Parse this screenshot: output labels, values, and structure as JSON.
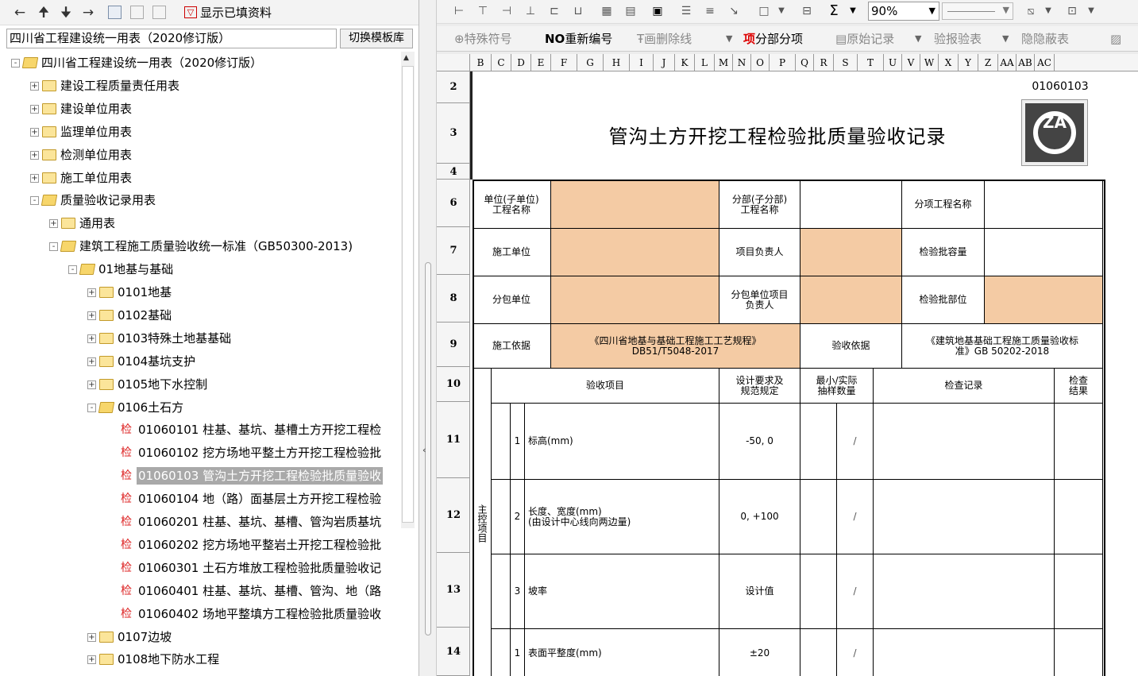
{
  "left_toolbar": {
    "show_filled_label": "显示已填资料",
    "filter_glyph": "▽"
  },
  "template_selector": {
    "value": "四川省工程建设统一用表（2020修订版）",
    "switch_button": "切换模板库"
  },
  "tree": [
    {
      "label": "四川省工程建设统一用表（2020修订版）",
      "level": 0,
      "type": "folder-open",
      "expander": "-"
    },
    {
      "label": "建设工程质量责任用表",
      "level": 1,
      "type": "folder",
      "expander": "+"
    },
    {
      "label": "建设单位用表",
      "level": 1,
      "type": "folder",
      "expander": "+"
    },
    {
      "label": "监理单位用表",
      "level": 1,
      "type": "folder",
      "expander": "+"
    },
    {
      "label": "检测单位用表",
      "level": 1,
      "type": "folder",
      "expander": "+"
    },
    {
      "label": "施工单位用表",
      "level": 1,
      "type": "folder",
      "expander": "+"
    },
    {
      "label": "质量验收记录用表",
      "level": 1,
      "type": "folder-open",
      "expander": "-"
    },
    {
      "label": "通用表",
      "level": 2,
      "type": "folder",
      "expander": "+"
    },
    {
      "label": "建筑工程施工质量验收统一标准（GB50300-2013)",
      "level": 2,
      "type": "folder-open",
      "expander": "-"
    },
    {
      "label": "01地基与基础",
      "level": 3,
      "type": "folder-open",
      "expander": "-"
    },
    {
      "label": "0101地基",
      "level": 4,
      "type": "folder",
      "expander": "+"
    },
    {
      "label": "0102基础",
      "level": 4,
      "type": "folder",
      "expander": "+"
    },
    {
      "label": "0103特殊土地基基础",
      "level": 4,
      "type": "folder",
      "expander": "+"
    },
    {
      "label": "0104基坑支护",
      "level": 4,
      "type": "folder",
      "expander": "+"
    },
    {
      "label": "0105地下水控制",
      "level": 4,
      "type": "folder",
      "expander": "+"
    },
    {
      "label": "0106土石方",
      "level": 4,
      "type": "folder-open",
      "expander": "-"
    },
    {
      "label": "01060101 柱基、基坑、基槽土方开挖工程检",
      "level": 5,
      "type": "check",
      "badge": "检"
    },
    {
      "label": "01060102 挖方场地平整土方开挖工程检验批",
      "level": 5,
      "type": "check",
      "badge": "检"
    },
    {
      "label": "01060103 管沟土方开挖工程检验批质量验收",
      "level": 5,
      "type": "check",
      "badge": "检",
      "selected": true
    },
    {
      "label": "01060104 地（路）面基层土方开挖工程检验",
      "level": 5,
      "type": "check",
      "badge": "检"
    },
    {
      "label": "01060201 柱基、基坑、基槽、管沟岩质基坑",
      "level": 5,
      "type": "check",
      "badge": "检"
    },
    {
      "label": "01060202 挖方场地平整岩土开挖工程检验批",
      "level": 5,
      "type": "check",
      "badge": "检"
    },
    {
      "label": "01060301 土石方堆放工程检验批质量验收记",
      "level": 5,
      "type": "check",
      "badge": "检"
    },
    {
      "label": "01060401 柱基、基坑、基槽、管沟、地（路",
      "level": 5,
      "type": "check",
      "badge": "检"
    },
    {
      "label": "01060402 场地平整填方工程检验批质量验收",
      "level": 5,
      "type": "check",
      "badge": "检"
    },
    {
      "label": "0107边坡",
      "level": 4,
      "type": "folder",
      "expander": "+"
    },
    {
      "label": "0108地下防水工程",
      "level": 4,
      "type": "folder",
      "expander": "+"
    }
  ],
  "right_toolbar": {
    "sigma": "Σ",
    "zoom": "90%",
    "special_symbol": "特殊符号",
    "renumber_no": "NO",
    "renumber": "重新编号",
    "strike": "画删除线",
    "item_mark": "项",
    "subitem": "分部分项",
    "original_record": "原始记录",
    "report_check": "报验表",
    "hidden_check": "隐蔽表",
    "jian_glyph": "验",
    "yin_glyph": "隐"
  },
  "sheet": {
    "columns": [
      "B",
      "C",
      "D",
      "E",
      "F",
      "G",
      "H",
      "I",
      "J",
      "K",
      "L",
      "M",
      "N",
      "O",
      "P",
      "Q",
      "R",
      "S",
      "T",
      "U",
      "V",
      "W",
      "X",
      "Y",
      "Z",
      "AA",
      "AB",
      "AC"
    ],
    "rows": [
      "2",
      "3",
      "4",
      "6",
      "7",
      "8",
      "9",
      "10",
      "11",
      "12",
      "13",
      "14"
    ],
    "form_code": "01060103",
    "form_title": "管沟土方开挖工程检验批质量验收记录",
    "logo_text": "ZA",
    "labels": {
      "unit_name": "单位(子单位)\n工程名称",
      "division_name": "分部(子分部)\n工程名称",
      "subitem_name": "分项工程名称",
      "contractor": "施工单位",
      "project_manager": "项目负责人",
      "batch_capacity": "检验批容量",
      "subcontractor": "分包单位",
      "sub_manager": "分包单位项目\n负责人",
      "batch_location": "检验批部位",
      "construction_basis": "施工依据",
      "basis_value": "《四川省地基与基础工程施工工艺规程》\nDB51/T5048-2017",
      "acceptance_basis": "验收依据",
      "acceptance_value": "《建筑地基基础工程施工质量验收标\n准》GB 50202-2018",
      "inspection_item": "验收项目",
      "design_req": "设计要求及\n规范规定",
      "sampling": "最小/实际\n抽样数量",
      "check_record": "检查记录",
      "check_result": "检查\n结果",
      "main_control": "主控项目"
    },
    "items": [
      {
        "no": "1",
        "name": "标高(mm)",
        "spec": "-50, 0",
        "slash": "/"
      },
      {
        "no": "2",
        "name": "长度、宽度(mm)\n(由设计中心线向两边量)",
        "spec": "0, +100",
        "slash": "/"
      },
      {
        "no": "3",
        "name": "坡率",
        "spec": "设计值",
        "slash": "/"
      },
      {
        "no": "1",
        "name": "表面平整度(mm)",
        "spec": "±20",
        "slash": "/"
      }
    ]
  },
  "colors": {
    "orange_fill": "#f4cba4",
    "selected_bg": "#a9a9a9",
    "check_red": "#dd2222"
  }
}
